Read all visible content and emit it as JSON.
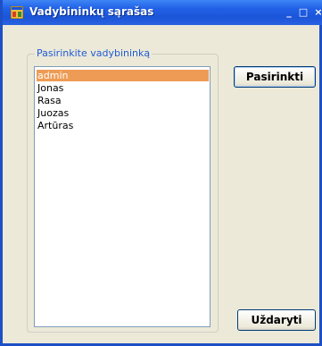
{
  "window": {
    "title": "Vadybininkų sąrašas",
    "controls": {
      "minimize": "_",
      "maximize": "□",
      "close": "×"
    }
  },
  "group": {
    "label": "Pasirinkite vadybininką"
  },
  "list": {
    "items": [
      "admin",
      "Jonas",
      "Rasa",
      "Juozas",
      "Artūras"
    ],
    "selected": "admin"
  },
  "buttons": {
    "select": "Pasirinkti",
    "close": "Uždaryti"
  },
  "colors": {
    "titlebar": "#2160e6",
    "selection": "#ee9c55",
    "group_label": "#1f5bd6"
  }
}
